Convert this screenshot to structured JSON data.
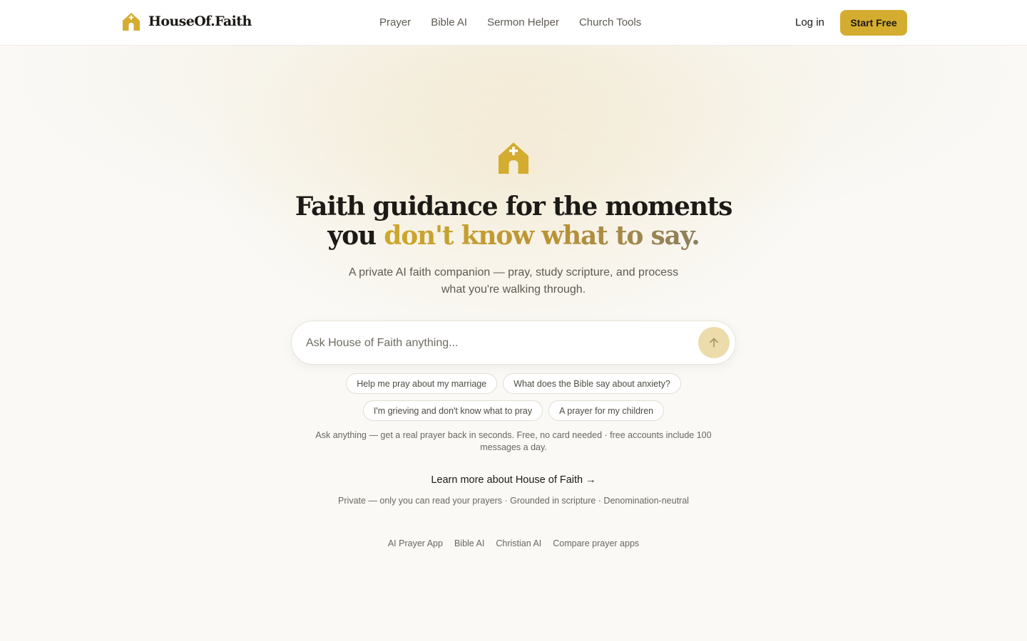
{
  "header": {
    "brand": "HouseOf.Faith",
    "nav": [
      "Prayer",
      "Bible AI",
      "Sermon Helper",
      "Church Tools"
    ],
    "login_label": "Log in",
    "cta_label": "Start Free"
  },
  "hero": {
    "headline_line1": "Faith guidance for the moments",
    "headline_line2_start": "you ",
    "headline_line2_accent": "don't know what to say.",
    "subtext": "A private AI faith companion — pray, study scripture, and process what you're walking through."
  },
  "search": {
    "placeholder": "Ask House of Faith anything..."
  },
  "suggestions": [
    [
      "Help me pray about my marriage",
      "What does the Bible say about anxiety?"
    ],
    [
      "I'm grieving and don't know what to pray",
      "A prayer for my children"
    ]
  ],
  "note": "Ask anything — get a real prayer back in seconds. Free, no card needed · free accounts include 100 messages a day.",
  "learn_more": "Learn more about House of Faith →",
  "trust_line": "Private — only you can read your prayers · Grounded in scripture · Denomination-neutral",
  "footer_links": [
    "AI Prayer App",
    "Bible AI",
    "Christian AI",
    "Compare prayer apps"
  ],
  "colors": {
    "accent": "#d4ac2f",
    "send_button": "#ecdcab",
    "background": "#faf9f6"
  },
  "icons": {
    "logo": "church-icon",
    "send": "arrow-up-icon"
  }
}
